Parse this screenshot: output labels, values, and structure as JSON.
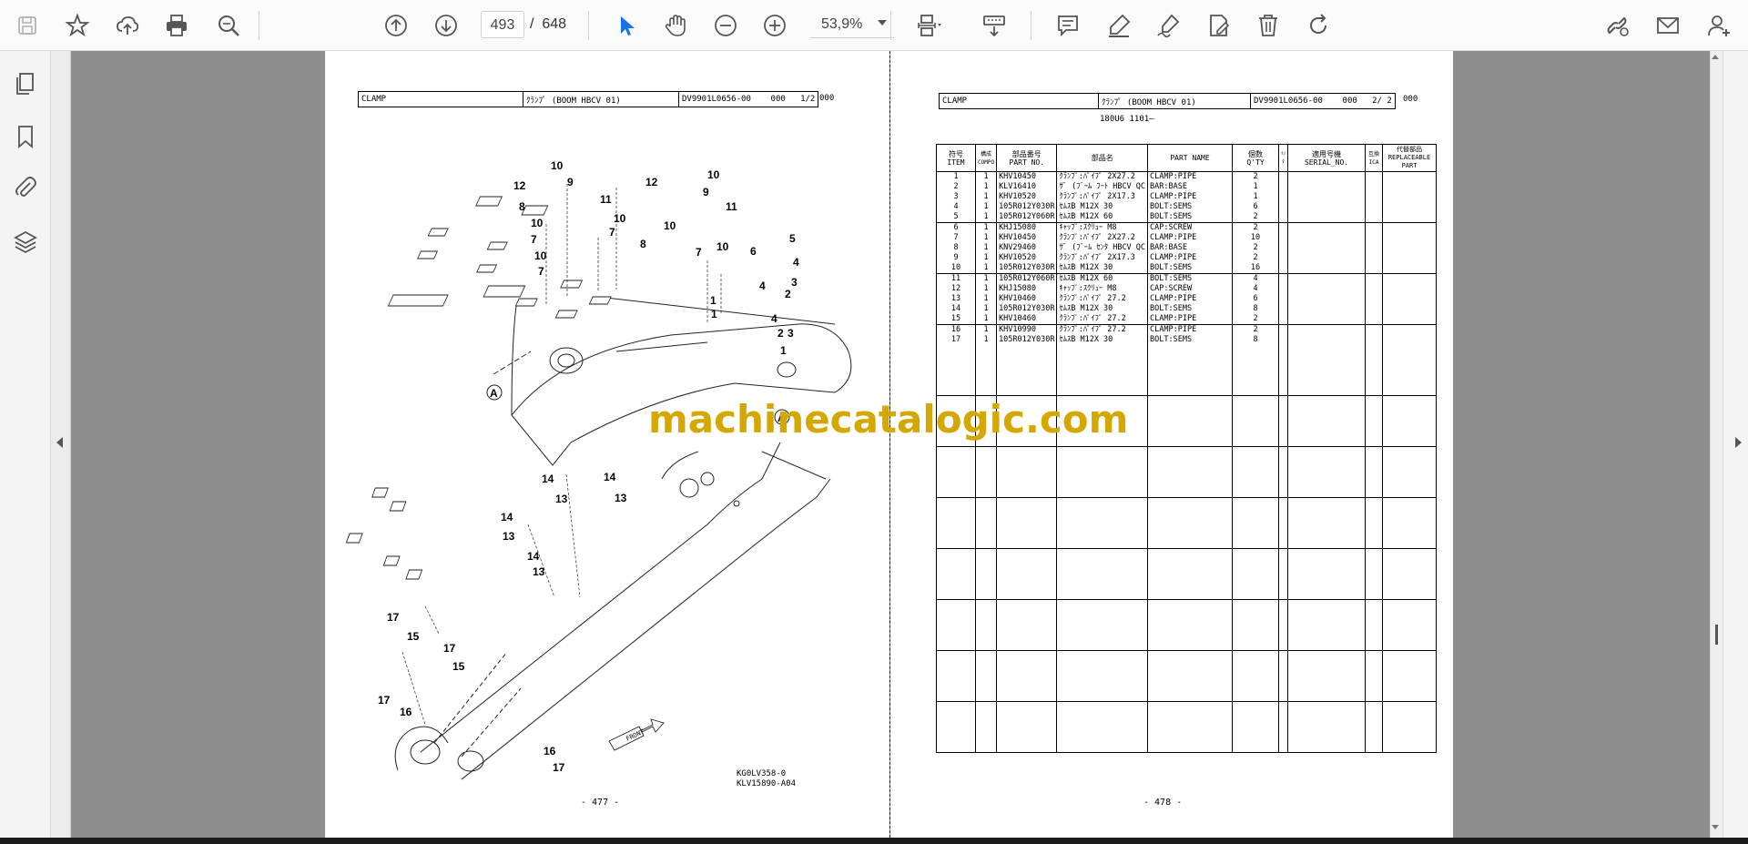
{
  "toolbar": {
    "current_page": "493",
    "page_separator": "/",
    "total_pages": "648",
    "zoom": "53,9%"
  },
  "watermark": "machinecatalogic.com",
  "left_page": {
    "header": {
      "name": "CLAMP",
      "jp_name": "ｸﾗﾝﾌﾟ (BOOM HBCV 01)",
      "code": "DV9901L0656-00",
      "rev": "000",
      "sheet": "1/2",
      "extra": "000"
    },
    "callouts": [
      "A",
      "A"
    ],
    "labels_top": [
      "10",
      "12",
      "9",
      "11",
      "8",
      "12",
      "10",
      "9",
      "11",
      "10",
      "7",
      "10",
      "7",
      "10",
      "7",
      "10",
      "8",
      "10",
      "7",
      "6",
      "5",
      "4",
      "3",
      "2",
      "4",
      "1",
      "4",
      "1",
      "3",
      "2",
      "1"
    ],
    "labels_bottom": [
      "14",
      "14",
      "13",
      "13",
      "14",
      "13",
      "14",
      "13",
      "17",
      "15",
      "17",
      "15",
      "17",
      "16",
      "16",
      "17"
    ],
    "front_label": "FRONT",
    "drawing_code_1": "KG0LV358-0",
    "drawing_code_2": "KLV15890-A04",
    "page_number": "- 477 -"
  },
  "right_page": {
    "header": {
      "name": "CLAMP",
      "jp_name": "ｸﾗﾝﾌﾟ (BOOM HBCV 01)",
      "code": "DV9901L0656-00",
      "rev": "000",
      "sheet": "2/ 2",
      "extra": "000"
    },
    "sub_header": "180U6 1101—",
    "columns": {
      "item_jp": "符号",
      "item": "ITEM",
      "comp_jp": "構成",
      "comp": "COMPO",
      "partno_jp": "部品番号",
      "partno": "PART NO.",
      "name_jp": "部品名",
      "pname": "PART  NAME",
      "qty_jp": "個数",
      "qty": "Q'TY",
      "ica": "ｲﾝﾀ",
      "serial_jp": "適用号機",
      "serial": "SERIAL_NO.",
      "ex_jp": "互換",
      "ex": "ICA",
      "rep_jp": "代替部品",
      "rep": "REPLACEABLE PART"
    },
    "rows": [
      {
        "item": "1",
        "comp": "1",
        "partno": "KHV10450",
        "jp": "ｸﾗﾝﾌﾟ:ﾊﾟｲﾌﾟ 2X27.2",
        "name": "CLAMP:PIPE",
        "qty": "2"
      },
      {
        "item": "2",
        "comp": "1",
        "partno": "KLV16410",
        "jp": "ｻﾞ (ﾌﾞｰﾑ ﾌｰﾄ HBCV QC",
        "name": "BAR:BASE",
        "qty": "1"
      },
      {
        "item": "3",
        "comp": "1",
        "partno": "KHV10520",
        "jp": "ｸﾗﾝﾌﾟ:ﾊﾟｲﾌﾟ 2X17.3",
        "name": "CLAMP:PIPE",
        "qty": "1"
      },
      {
        "item": "4",
        "comp": "1",
        "partno": "105R012Y030R",
        "jp": "ｾﾑｽB M12X 30",
        "name": "BOLT:SEMS",
        "qty": "6"
      },
      {
        "item": "5",
        "comp": "1",
        "partno": "105R012Y060R",
        "jp": "ｾﾑｽB M12X 60",
        "name": "BOLT:SEMS",
        "qty": "2"
      },
      {
        "item": "6",
        "comp": "1",
        "partno": "KHJ15080",
        "jp": "ｷｬｯﾌﾟ:ｽｸﾘｭｰ M8",
        "name": "CAP:SCREW",
        "qty": "2"
      },
      {
        "item": "7",
        "comp": "1",
        "partno": "KHV10450",
        "jp": "ｸﾗﾝﾌﾟ:ﾊﾟｲﾌﾟ 2X27.2",
        "name": "CLAMP:PIPE",
        "qty": "10"
      },
      {
        "item": "8",
        "comp": "1",
        "partno": "KNV29460",
        "jp": "ｻﾞ (ﾌﾞｰﾑ ｾﾝﾀ HBCV QC",
        "name": "BAR:BASE",
        "qty": "2"
      },
      {
        "item": "9",
        "comp": "1",
        "partno": "KHV10520",
        "jp": "ｸﾗﾝﾌﾟ:ﾊﾟｲﾌﾟ 2X17.3",
        "name": "CLAMP:PIPE",
        "qty": "2"
      },
      {
        "item": "10",
        "comp": "1",
        "partno": "105R012Y030R",
        "jp": "ｾﾑｽB M12X 30",
        "name": "BOLT:SEMS",
        "qty": "16"
      },
      {
        "item": "11",
        "comp": "1",
        "partno": "105R012Y060R",
        "jp": "ｾﾑｽB M12X 60",
        "name": "BOLT:SEMS",
        "qty": "4"
      },
      {
        "item": "12",
        "comp": "1",
        "partno": "KHJ15080",
        "jp": "ｷｬｯﾌﾟ:ｽｸﾘｭｰ M8",
        "name": "CAP:SCREW",
        "qty": "4"
      },
      {
        "item": "13",
        "comp": "1",
        "partno": "KHV10460",
        "jp": "ｸﾗﾝﾌﾟ:ﾊﾟｲﾌﾟ 27.2",
        "name": "CLAMP:PIPE",
        "qty": "6"
      },
      {
        "item": "14",
        "comp": "1",
        "partno": "105R012Y030R",
        "jp": "ｾﾑｽB M12X 30",
        "name": "BOLT:SEMS",
        "qty": "8"
      },
      {
        "item": "15",
        "comp": "1",
        "partno": "KHV10460",
        "jp": "ｸﾗﾝﾌﾟ:ﾊﾟｲﾌﾟ 27.2",
        "name": "CLAMP:PIPE",
        "qty": "2"
      },
      {
        "item": "16",
        "comp": "1",
        "partno": "KHV10990",
        "jp": "ｸﾗﾝﾌﾟ:ﾊﾟｲﾌﾟ 27.2",
        "name": "CLAMP:PIPE",
        "qty": "2"
      },
      {
        "item": "17",
        "comp": "1",
        "partno": "105R012Y030R",
        "jp": "ｾﾑｽB M12X 30",
        "name": "BOLT:SEMS",
        "qty": "8"
      }
    ],
    "page_number": "- 478 -"
  }
}
